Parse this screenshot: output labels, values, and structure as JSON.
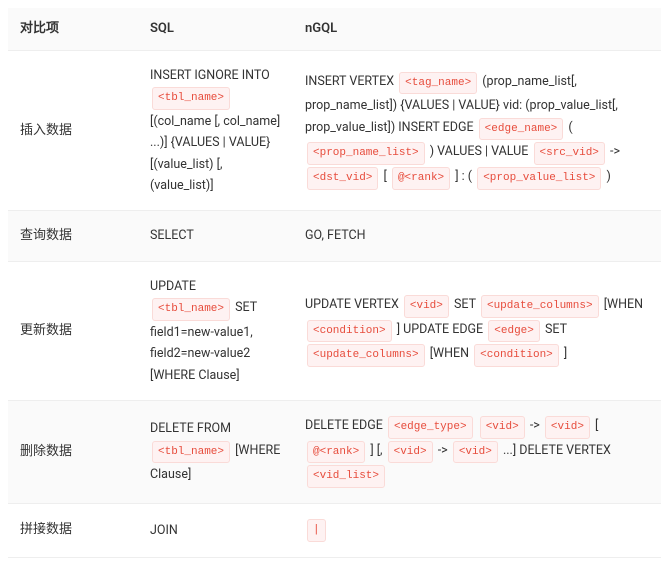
{
  "headers": {
    "col1": "对比项",
    "col2": "SQL",
    "col3": "nGQL"
  },
  "rows": {
    "insert": {
      "label": "插入数据",
      "sql": {
        "t1": "INSERT IGNORE INTO ",
        "c1": "<tbl_name>",
        "t2": " [(col_name [, col_name] ...)] {VALUES | VALUE} [(value_list) [, (value_list)]"
      },
      "ngql": {
        "t1": "INSERT VERTEX ",
        "c1": "<tag_name>",
        "t2": " (prop_name_list[, prop_name_list]) {VALUES | VALUE} vid: (prop_value_list[, prop_value_list]) INSERT EDGE ",
        "c2": "<edge_name>",
        "t3": " ( ",
        "c3": "<prop_name_list>",
        "t4": " ) VALUES | VALUE ",
        "c4": "<src_vid>",
        "t5": " -> ",
        "c5": "<dst_vid>",
        "t6": " [ ",
        "c6": "@<rank>",
        "t7": " ] : ( ",
        "c7": "<prop_value_list>",
        "t8": " )"
      }
    },
    "query": {
      "label": "查询数据",
      "sql": "SELECT",
      "ngql": "GO, FETCH"
    },
    "update": {
      "label": "更新数据",
      "sql": {
        "t1": "UPDATE ",
        "c1": "<tbl_name>",
        "t2": " SET field1=new-value1, field2=new-value2 [WHERE Clause]"
      },
      "ngql": {
        "t1": "UPDATE VERTEX ",
        "c1": "<vid>",
        "t2": " SET ",
        "c2": "<update_columns>",
        "t3": " [WHEN ",
        "c3": "<condition>",
        "t4": " ] UPDATE EDGE ",
        "c4": "<edge>",
        "t5": " SET ",
        "c5": "<update_columns>",
        "t6": " [WHEN ",
        "c6": "<condition>",
        "t7": " ]"
      }
    },
    "delete": {
      "label": "删除数据",
      "sql": {
        "t1": "DELETE FROM ",
        "c1": "<tbl_name>",
        "t2": " [WHERE Clause]"
      },
      "ngql": {
        "t1": "DELETE EDGE ",
        "c1": "<edge_type>",
        "t2": " ",
        "c2": "<vid>",
        "t3": " -> ",
        "c3": "<vid>",
        "t4": " [ ",
        "c4": "@<rank>",
        "t5": " ] [, ",
        "c5": "<vid>",
        "t6": " -> ",
        "c6": "<vid>",
        "t7": " ...] DELETE VERTEX ",
        "c7": "<vid_list>"
      }
    },
    "join": {
      "label": "拼接数据",
      "sql": "JOIN",
      "ngql": "|"
    }
  }
}
